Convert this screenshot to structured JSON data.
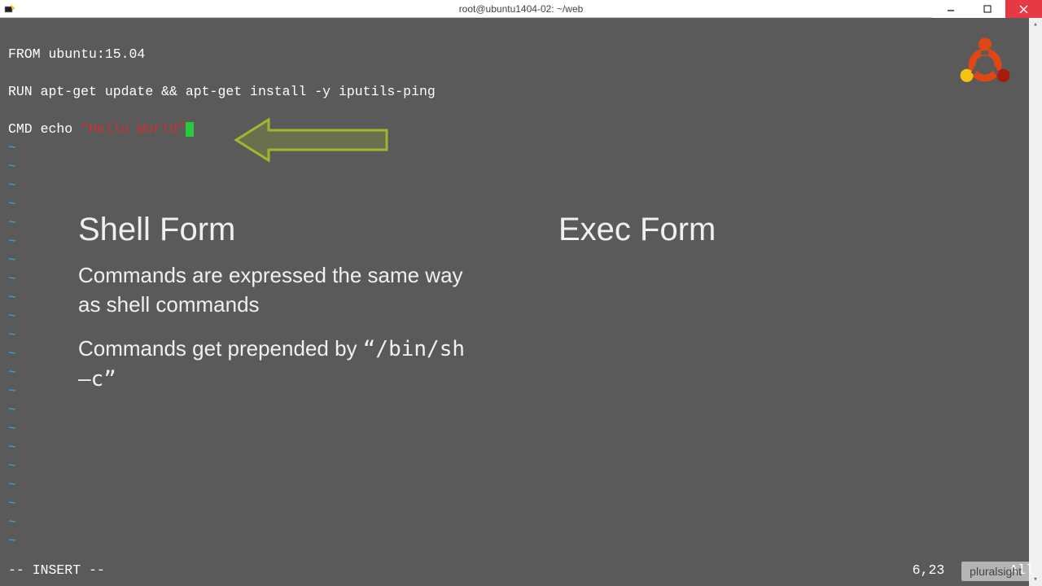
{
  "titlebar": {
    "title": "root@ubuntu1404-02: ~/web"
  },
  "code": {
    "line1": "FROM ubuntu:15.04",
    "line2": "RUN apt-get update && apt-get install -y iputils-ping",
    "line3_prefix": "CMD echo ",
    "line3_string": "\"Hello World\""
  },
  "vim": {
    "mode": "-- INSERT --",
    "position": "6,23",
    "scroll": "All"
  },
  "overlay": {
    "shell_title": "Shell Form",
    "exec_title": "Exec Form",
    "shell_desc1": "Commands are expressed the same way as shell commands",
    "shell_desc2_pre": "Commands get prepended by ",
    "shell_desc2_code": "“/bin/sh –c”"
  },
  "watermark": "pluralsight"
}
